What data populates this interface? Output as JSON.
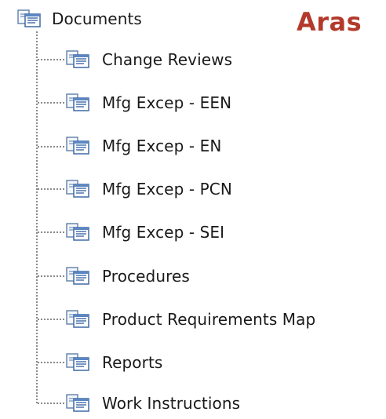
{
  "brand": {
    "logo_text": "Aras",
    "color": "#b33a2b"
  },
  "tree": {
    "root": {
      "label": "Documents",
      "icon": "document-folder-icon"
    },
    "children": [
      {
        "label": "Change Reviews",
        "icon": "document-folder-icon"
      },
      {
        "label": "Mfg Excep - EEN",
        "icon": "document-folder-icon"
      },
      {
        "label": "Mfg Excep - EN",
        "icon": "document-folder-icon"
      },
      {
        "label": "Mfg Excep - PCN",
        "icon": "document-folder-icon"
      },
      {
        "label": "Mfg Excep - SEI",
        "icon": "document-folder-icon"
      },
      {
        "label": "Procedures",
        "icon": "document-folder-icon"
      },
      {
        "label": "Product Requirements Map",
        "icon": "document-folder-icon"
      },
      {
        "label": "Reports",
        "icon": "document-folder-icon"
      },
      {
        "label": "Work Instructions",
        "icon": "document-folder-icon"
      }
    ]
  }
}
